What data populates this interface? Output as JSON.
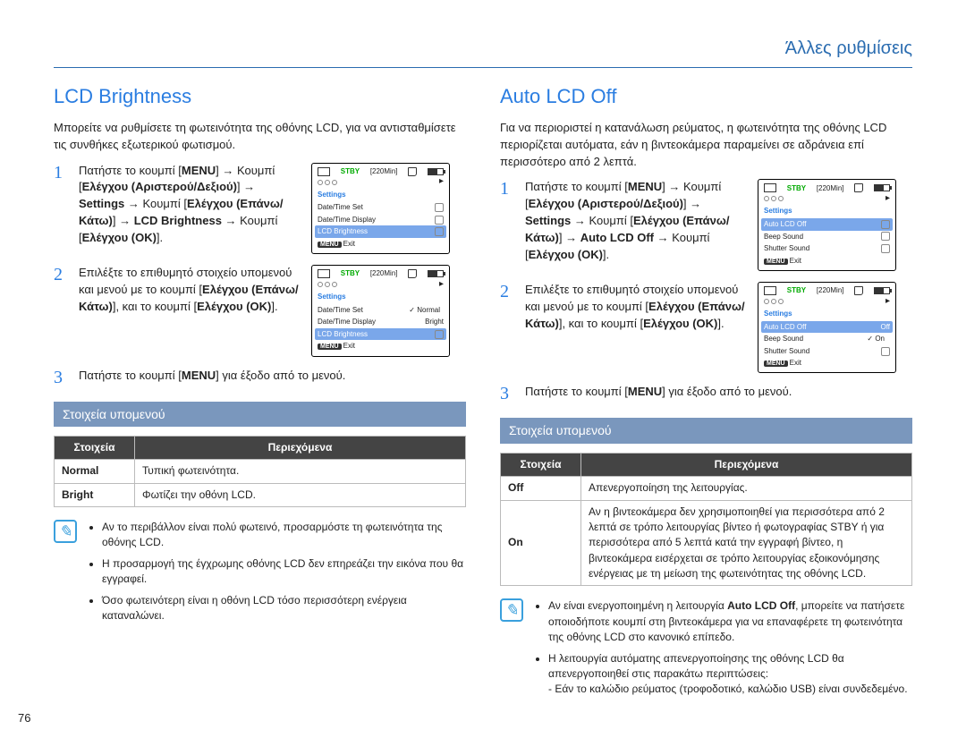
{
  "header": {
    "section": "Άλλες ρυθμίσεις"
  },
  "page_number": "76",
  "lcd": {
    "title": "LCD Brightness",
    "intro": "Μπορείτε να ρυθμίσετε τη φωτεινότητα της οθόνης LCD, για να αντισταθμίσετε τις συνθήκες εξωτερικού φωτισμού.",
    "step1_a": "Πατήστε το κουμπί [",
    "step1_menu": "MENU",
    "step1_b": "] →",
    "step1_c": "Κουμπί [",
    "step1_nav1": "Ελέγχου (Αριστερού/Δεξιού)",
    "step1_d": "] → ",
    "step1_settings": "Settings",
    "step1_e": " → Κουμπί [",
    "step1_nav2": "Ελέγχου (Επάνω/Κάτω)",
    "step1_f": "] → ",
    "step1_item": "LCD Brightness",
    "step1_g": " → Κουμπί [",
    "step1_ok": "Ελέγχου (OK)",
    "step1_h": "].",
    "step2_a": "Επιλέξτε το επιθυμητό στοιχείο υπομενού και μενού με το κουμπί [",
    "step2_nav": "Ελέγχου (Επάνω/Κάτω)",
    "step2_b": "], και το κουμπί [",
    "step2_ok": "Ελέγχου (OK)",
    "step2_c": "].",
    "step3_a": "Πατήστε το κουμπί [",
    "step3_menu": "MENU",
    "step3_b": "] για έξοδο από το μενού.",
    "submenu_heading": "Στοιχεία υπομενού",
    "tbl_h1": "Στοιχεία",
    "tbl_h2": "Περιεχόμενα",
    "row1_k": "Normal",
    "row1_v": "Τυπική φωτεινότητα.",
    "row2_k": "Bright",
    "row2_v": "Φωτίζει την οθόνη LCD.",
    "note1": "Αν το περιβάλλον είναι πολύ φωτεινό, προσαρμόστε τη φωτεινότητα της οθόνης LCD.",
    "note2": "Η προσαρμογή της έγχρωμης οθόνης LCD δεν επηρεάζει την εικόνα που θα εγγραφεί.",
    "note3": "Όσο φωτεινότερη είναι η οθόνη LCD τόσο περισσότερη ενέργεια καταναλώνει.",
    "ms1": {
      "stby": "STBY",
      "time": "[220Min]",
      "settings": "Settings",
      "i1": "Date/Time Set",
      "i2": "Date/Time Display",
      "i3": "LCD Brightness",
      "exit_btn": "MENU",
      "exit": "Exit"
    },
    "ms2": {
      "stby": "STBY",
      "time": "[220Min]",
      "settings": "Settings",
      "i1": "Date/Time Set",
      "i2": "Date/Time Display",
      "i3": "LCD Brightness",
      "opt1": "Normal",
      "opt2": "Bright",
      "exit_btn": "MENU",
      "exit": "Exit"
    }
  },
  "auto": {
    "title": "Auto LCD Off",
    "intro": "Για να περιοριστεί η κατανάλωση ρεύματος, η φωτεινότητα της οθόνης LCD περιορίζεται αυτόματα, εάν η βιντεοκάμερα παραμείνει σε αδράνεια επί περισσότερο από 2 λεπτά.",
    "step1_a": "Πατήστε το κουμπί [",
    "step1_menu": "MENU",
    "step1_b": "] →",
    "step1_c": "Κουμπί [",
    "step1_nav1": "Ελέγχου (Αριστερού/Δεξιού)",
    "step1_d": "] → ",
    "step1_settings": "Settings",
    "step1_e": " → Κουμπί [",
    "step1_nav2": "Ελέγχου (Επάνω/Κάτω)",
    "step1_f": "] → ",
    "step1_item": "Auto LCD Off",
    "step1_g": " → Κουμπί [",
    "step1_ok": "Ελέγχου (OK)",
    "step1_h": "].",
    "step2_a": "Επιλέξτε το επιθυμητό στοιχείο υπομενού και μενού με το κουμπί [",
    "step2_nav": "Ελέγχου (Επάνω/Κάτω)",
    "step2_b": "], και το κουμπί [",
    "step2_ok": "Ελέγχου (OK)",
    "step2_c": "].",
    "step3_a": "Πατήστε το κουμπί [",
    "step3_menu": "MENU",
    "step3_b": "] για έξοδο από το μενού.",
    "submenu_heading": "Στοιχεία υπομενού",
    "tbl_h1": "Στοιχεία",
    "tbl_h2": "Περιεχόμενα",
    "row1_k": "Off",
    "row1_v": "Απενεργοποίηση της λειτουργίας.",
    "row2_k": "On",
    "row2_v": "Αν η βιντεοκάμερα δεν χρησιμοποιηθεί για περισσότερα από 2 λεπτά σε τρόπο λειτουργίας βίντεο ή φωτογραφίας STBY ή για περισσότερα από 5 λεπτά κατά την εγγραφή βίντεο, η βιντεοκάμερα εισέρχεται σε τρόπο λειτουργίας εξοικονόμησης ενέργειας με τη μείωση της φωτεινότητας της οθόνης LCD.",
    "note1a": "Αν είναι ενεργοποιημένη η λειτουργία ",
    "note1bold": "Auto LCD Off",
    "note1b": ", μπορείτε να πατήσετε οποιοδήποτε κουμπί στη βιντεοκάμερα για να επαναφέρετε τη φωτεινότητα της οθόνης LCD στο κανονικό επίπεδο.",
    "note2": "Η λειτουργία αυτόματης απενεργοποίησης της οθόνης LCD θα απενεργοποιηθεί στις παρακάτω περιπτώσεις:",
    "note2_sub": "- Εάν το καλώδιο ρεύματος (τροφοδοτικό, καλώδιο USB) είναι συνδεδεμένο.",
    "ms1": {
      "stby": "STBY",
      "time": "[220Min]",
      "settings": "Settings",
      "i1": "Auto LCD Off",
      "i2": "Beep Sound",
      "i3": "Shutter Sound",
      "exit_btn": "MENU",
      "exit": "Exit"
    },
    "ms2": {
      "stby": "STBY",
      "time": "[220Min]",
      "settings": "Settings",
      "i1": "Auto LCD Off",
      "i2": "Beep Sound",
      "i3": "Shutter Sound",
      "opt1": "Off",
      "opt2": "On",
      "exit_btn": "MENU",
      "exit": "Exit"
    }
  }
}
